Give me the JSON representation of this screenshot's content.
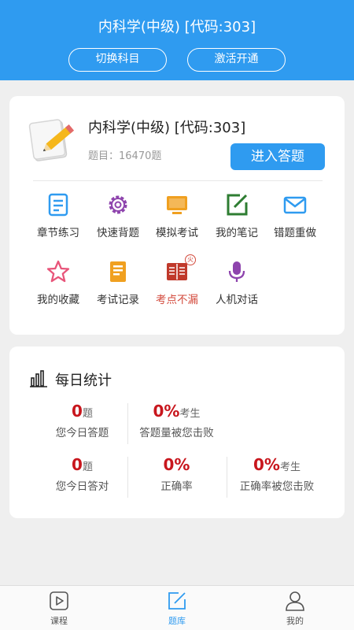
{
  "header": {
    "title": "内科学(中级) [代码:303]",
    "switch_label": "切换科目",
    "activate_label": "激活开通"
  },
  "subject": {
    "title": "内科学(中级) [代码:303]",
    "count": "题目：16470题",
    "enter_label": "进入答题"
  },
  "functions": [
    {
      "label": "章节练习",
      "icon": "chapter-doc-icon",
      "color": "#2f9bf0"
    },
    {
      "label": "快速背题",
      "icon": "gear-icon",
      "color": "#8e44ad"
    },
    {
      "label": "模拟考试",
      "icon": "monitor-icon",
      "color": "#f0a020"
    },
    {
      "label": "我的笔记",
      "icon": "note-edit-icon",
      "color": "#2e7d32"
    },
    {
      "label": "错题重做",
      "icon": "envelope-icon",
      "color": "#2f9bf0"
    },
    {
      "label": "我的收藏",
      "icon": "star-icon",
      "color": "#e8557a"
    },
    {
      "label": "考试记录",
      "icon": "record-icon",
      "color": "#f0a020"
    },
    {
      "label": "考点不漏",
      "icon": "book-icon",
      "color": "#c0392b",
      "badge": "火"
    },
    {
      "label": "人机对话",
      "icon": "microphone-icon",
      "color": "#8e44ad"
    }
  ],
  "stats": {
    "title": "每日统计",
    "items": [
      {
        "value": "0",
        "unit": "题",
        "desc": "您今日答题"
      },
      {
        "value": "0%",
        "unit": "考生",
        "desc": "答题量被您击败"
      },
      {
        "value": "0",
        "unit": "题",
        "desc": "您今日答对"
      },
      {
        "value": "0%",
        "unit": "",
        "desc": "正确率"
      },
      {
        "value": "0%",
        "unit": "考生",
        "desc": "正确率被您击败"
      }
    ]
  },
  "tabs": [
    {
      "label": "课程"
    },
    {
      "label": "题库",
      "active": true
    },
    {
      "label": "我的"
    }
  ],
  "colors": {
    "primary": "#2f9bf0",
    "stat_red": "#c8161d",
    "background": "#efefef"
  }
}
